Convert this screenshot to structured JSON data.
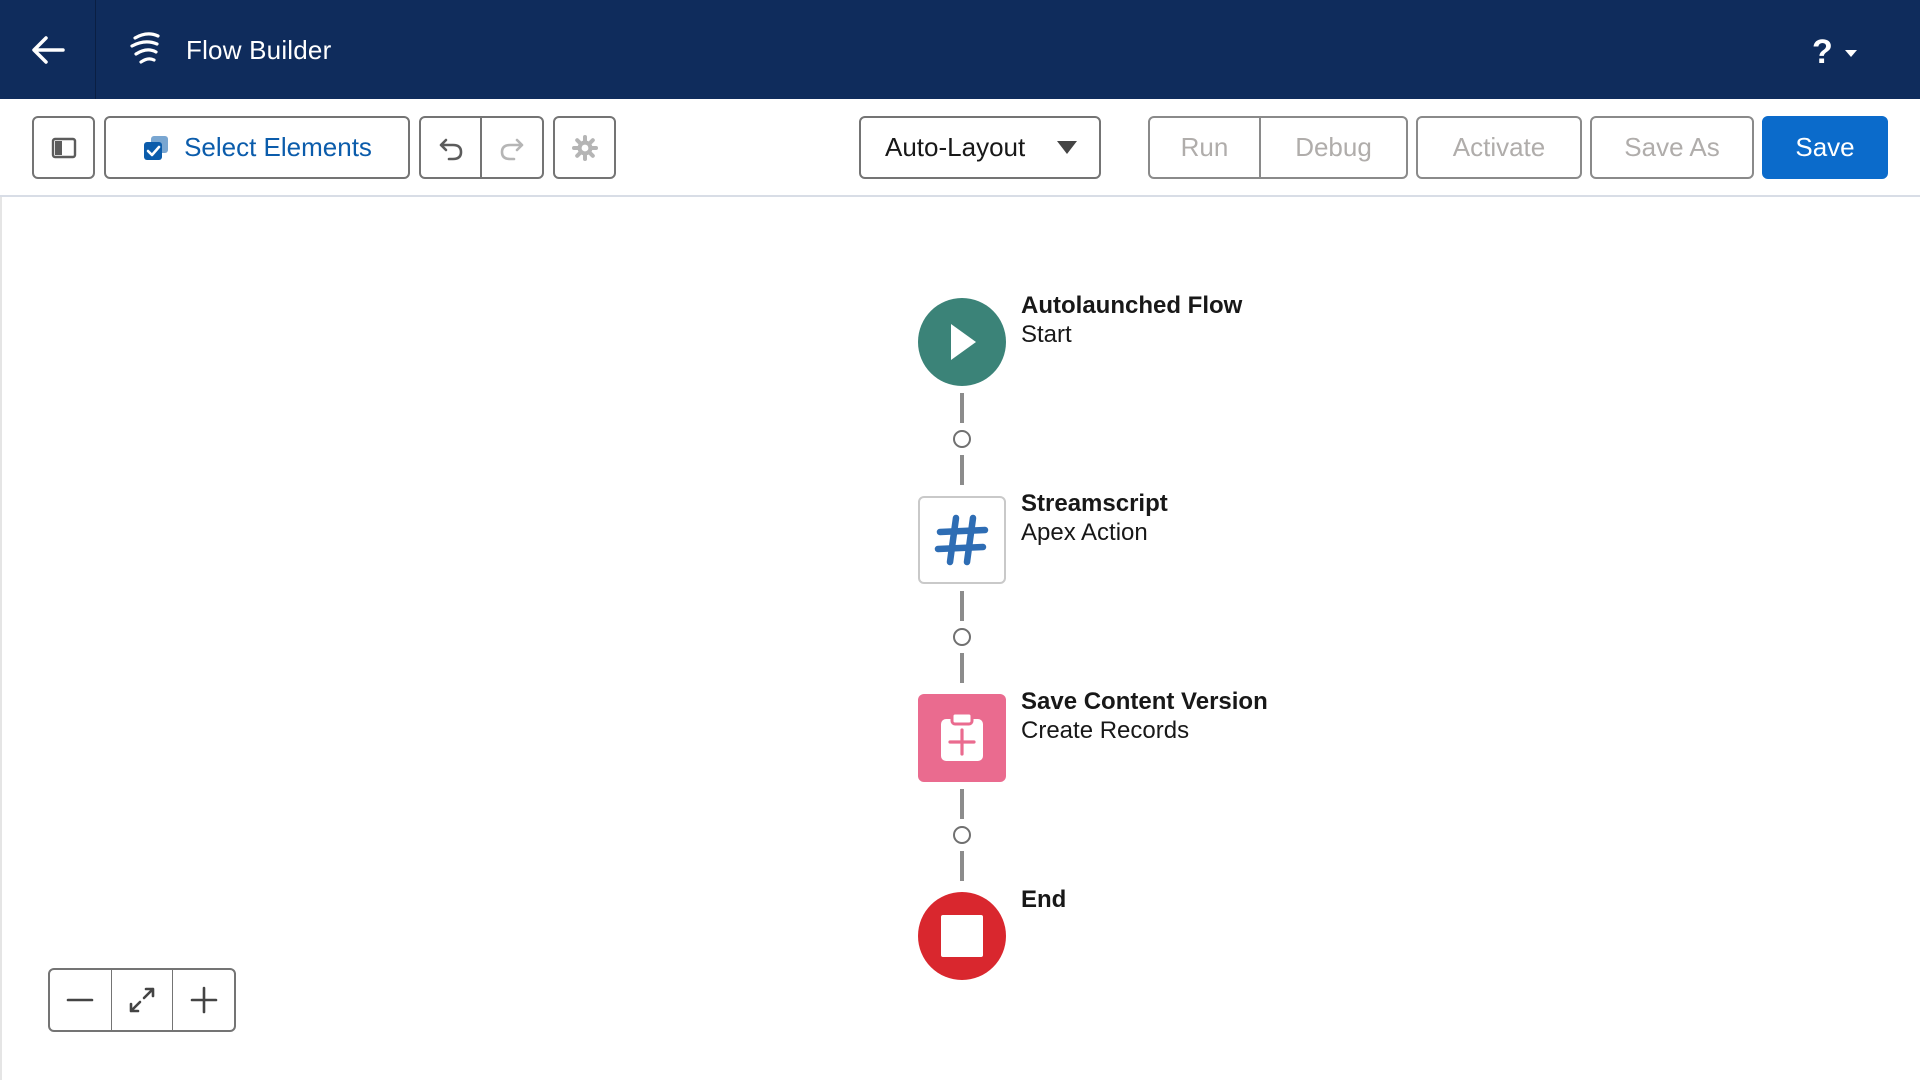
{
  "header": {
    "back_icon": "arrow-left-icon",
    "app_icon": "flow-icon",
    "title": "Flow Builder",
    "help_label": "?",
    "help_caret_icon": "chevron-down-icon"
  },
  "toolbar": {
    "panel_toggle_icon": "panel-toggle-icon",
    "select_elements_icon": "checkbox-stack-icon",
    "select_elements_label": "Select Elements",
    "undo_icon": "undo-icon",
    "redo_icon": "redo-icon",
    "settings_icon": "gear-icon",
    "layout_value": "Auto-Layout",
    "run_label": "Run",
    "debug_label": "Debug",
    "activate_label": "Activate",
    "save_as_label": "Save As",
    "save_label": "Save"
  },
  "flow": {
    "nodes": [
      {
        "type": "start",
        "icon": "play-icon",
        "title": "Autolaunched Flow",
        "subtitle": "Start",
        "color": "#3b8378"
      },
      {
        "type": "apex-action",
        "icon": "hashtag-icon",
        "title": "Streamscript",
        "subtitle": "Apex Action",
        "color": "#2e6db4"
      },
      {
        "type": "create-records",
        "icon": "clipboard-add-icon",
        "title": "Save Content Version",
        "subtitle": "Create Records",
        "color": "#ea6b8f"
      },
      {
        "type": "end",
        "icon": "stop-icon",
        "title": "End",
        "subtitle": "",
        "color": "#d9272e"
      }
    ]
  },
  "zoom": {
    "zoom_out_icon": "minus-icon",
    "fit_icon": "expand-icon",
    "zoom_in_icon": "plus-icon"
  },
  "colors": {
    "header_bg": "#0f2c5c",
    "brand_blue": "#0b6bcb",
    "link_blue": "#0b5cab",
    "disabled_text": "#b0adab"
  }
}
